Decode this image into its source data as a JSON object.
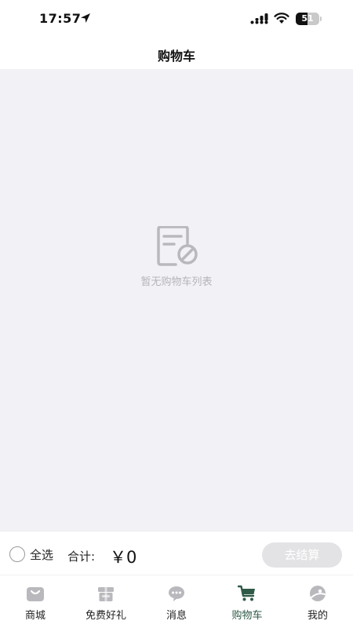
{
  "status_bar": {
    "time": "17:57",
    "battery_level": "51"
  },
  "header": {
    "title": "购物车"
  },
  "empty_state": {
    "icon": "document-cancel-icon",
    "text": "暂无购物车列表"
  },
  "checkout": {
    "select_all_label": "全选",
    "total_label": "合计:",
    "total_value": "￥0",
    "checkout_label": "去结算"
  },
  "tabs": [
    {
      "label": "商城",
      "icon": "shopping-bag-icon"
    },
    {
      "label": "免费好礼",
      "icon": "gift-box-icon"
    },
    {
      "label": "消息",
      "icon": "chat-bubble-icon"
    },
    {
      "label": "购物车",
      "icon": "cart-icon",
      "active": true
    },
    {
      "label": "我的",
      "icon": "profile-icon"
    }
  ],
  "colors": {
    "accent": "#2f5a47",
    "content_background": "#f2f2f6",
    "inactive_icon": "#b9b9bd",
    "checkout_button_disabled": "#e3e3e6"
  }
}
